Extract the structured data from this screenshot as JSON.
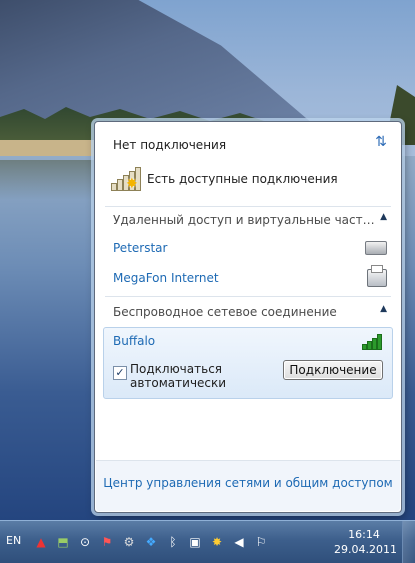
{
  "popup": {
    "status_title": "Нет подключения",
    "available_text": "Есть доступные подключения",
    "dialup_section": {
      "header": "Удаленный доступ и виртуальные частные се...",
      "items": [
        {
          "name": "Peterstar",
          "icon": "modem-icon"
        },
        {
          "name": "MegaFon Internet",
          "icon": "fax-modem-icon"
        }
      ]
    },
    "wireless_section": {
      "header": "Беспроводное сетевое соединение",
      "network": {
        "name": "Buffalo",
        "auto_connect_label": "Подключаться автоматически",
        "auto_connect_checked": true,
        "connect_button": "Подключение"
      }
    },
    "footer_link": "Центр управления сетями и общим доступом"
  },
  "taskbar": {
    "language": "EN",
    "time": "16:14",
    "date": "29.04.2011",
    "tray_icons": [
      "antivirus-icon",
      "usb-icon",
      "skype-icon",
      "flag-icon",
      "gear-icon",
      "bluetooth-blue-icon",
      "bluetooth-icon",
      "device-icon",
      "network-icon",
      "volume-icon",
      "action-center-icon"
    ]
  },
  "colors": {
    "link": "#1e6ab4",
    "taskbar": "#3d5f8c",
    "signal": "#2c9a2c"
  }
}
